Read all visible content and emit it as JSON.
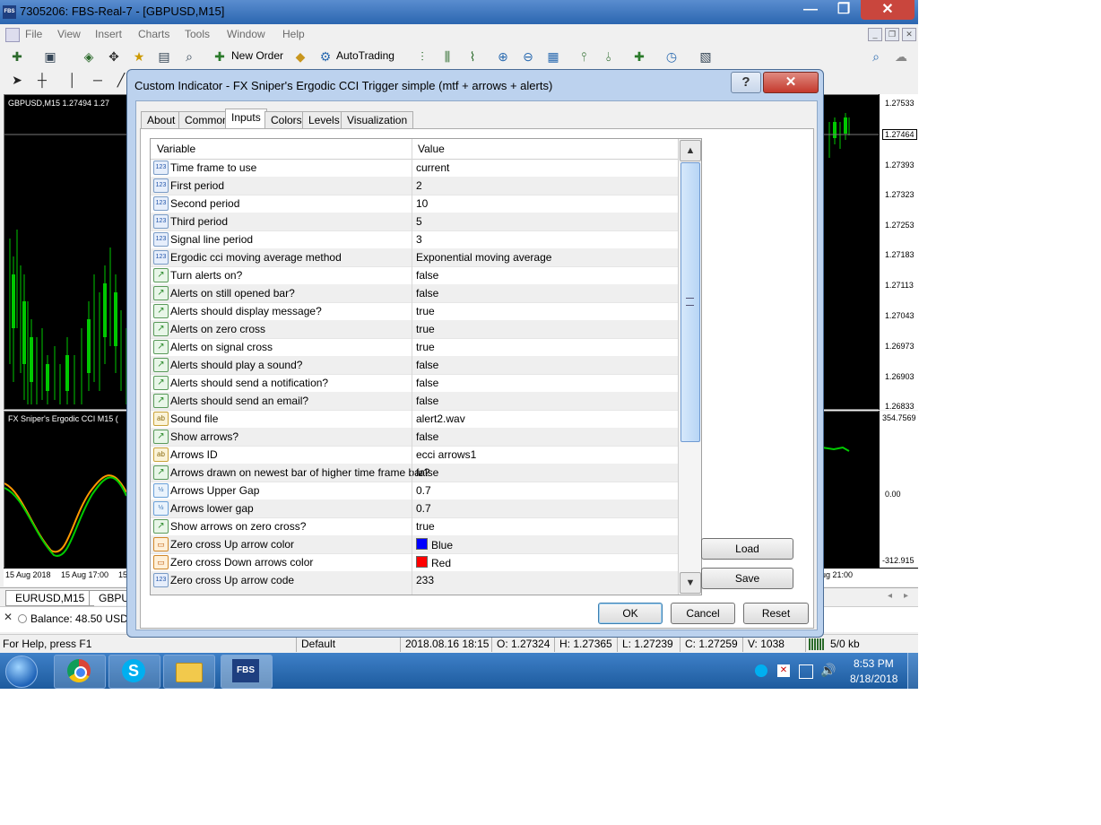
{
  "window": {
    "title": "7305206: FBS-Real-7 - [GBPUSD,M15]",
    "app_icon": "FBS",
    "minimize_label": "—",
    "maximize_label": "❐",
    "close_label": "✕"
  },
  "menu": [
    "File",
    "View",
    "Insert",
    "Charts",
    "Tools",
    "Window",
    "Help"
  ],
  "toolbar": {
    "new_order_label": "New Order",
    "autotrading_label": "AutoTrading"
  },
  "chart": {
    "symbol_label": "GBPUSD,M15  1.27494 1.27",
    "price_ticks": [
      "1.27533",
      "1.27464",
      "1.27393",
      "1.27323",
      "1.27253",
      "1.27183",
      "1.27113",
      "1.27043",
      "1.26973",
      "1.26903",
      "1.26833"
    ],
    "current_price": "1.27464",
    "indicator_label": "FX Sniper's Ergodic CCI M15 (",
    "indicator_ticks": [
      "354.7569",
      "0.00",
      "-312.915"
    ],
    "time_labels": [
      "15 Aug 2018",
      "15 Aug 17:00",
      "15",
      "ug 21:00"
    ],
    "tabs": [
      "EURUSD,M15",
      "GBPUS"
    ]
  },
  "terminal": {
    "balance_text": "Balance: 48.50 USD"
  },
  "statusbar": {
    "help": "For Help, press F1",
    "profile": "Default",
    "datetime": "2018.08.16 18:15",
    "open": "O: 1.27324",
    "high": "H: 1.27365",
    "low": "L: 1.27239",
    "close": "C: 1.27259",
    "volume": "V: 1038",
    "traffic": "5/0 kb"
  },
  "taskbar": {
    "time": "8:53 PM",
    "date": "8/18/2018",
    "fbs_label": "FBS"
  },
  "dialog": {
    "title": "Custom Indicator - FX Sniper's Ergodic CCI Trigger simple (mtf + arrows + alerts)",
    "help_label": "?",
    "close_label": "✕",
    "tabs": [
      "About",
      "Common",
      "Inputs",
      "Colors",
      "Levels",
      "Visualization"
    ],
    "active_tab": "Inputs",
    "grid": {
      "col_variable": "Variable",
      "col_value": "Value",
      "rows": [
        {
          "var": "Time frame to use",
          "val": "current",
          "icon": "123"
        },
        {
          "var": "First period",
          "val": "2",
          "icon": "123"
        },
        {
          "var": "Second period",
          "val": "10",
          "icon": "123"
        },
        {
          "var": "Third period",
          "val": "5",
          "icon": "123"
        },
        {
          "var": "Signal line period",
          "val": "3",
          "icon": "123"
        },
        {
          "var": "Ergodic cci moving average method",
          "val": "Exponential moving average",
          "icon": "123"
        },
        {
          "var": "Turn alerts on?",
          "val": "false",
          "icon": "bool"
        },
        {
          "var": "Alerts on still opened bar?",
          "val": "false",
          "icon": "bool"
        },
        {
          "var": "Alerts should display message?",
          "val": "true",
          "icon": "bool"
        },
        {
          "var": "Alerts on zero cross",
          "val": "true",
          "icon": "bool"
        },
        {
          "var": "Alerts on signal cross",
          "val": "true",
          "icon": "bool"
        },
        {
          "var": "Alerts should play a sound?",
          "val": "false",
          "icon": "bool"
        },
        {
          "var": "Alerts should send a notification?",
          "val": "false",
          "icon": "bool"
        },
        {
          "var": "Alerts should send an email?",
          "val": "false",
          "icon": "bool"
        },
        {
          "var": "Sound file",
          "val": "alert2.wav",
          "icon": "ab"
        },
        {
          "var": "Show arrows?",
          "val": "false",
          "icon": "bool"
        },
        {
          "var": "Arrows ID",
          "val": "ecci arrows1",
          "icon": "ab"
        },
        {
          "var": "Arrows drawn on newest bar of higher time frame bar?",
          "val": "false",
          "icon": "bool"
        },
        {
          "var": "Arrows Upper Gap",
          "val": "0.7",
          "icon": "dbl"
        },
        {
          "var": "Arrows lower gap",
          "val": "0.7",
          "icon": "dbl"
        },
        {
          "var": "Show arrows on zero cross?",
          "val": "true",
          "icon": "bool"
        },
        {
          "var": "Zero cross Up arrow color",
          "val": "Blue",
          "icon": "clr",
          "swatch": "#0000ff"
        },
        {
          "var": "Zero cross Down arrows color",
          "val": "Red",
          "icon": "clr",
          "swatch": "#ff0000"
        },
        {
          "var": "Zero cross Up arrow code",
          "val": "233",
          "icon": "123"
        }
      ]
    },
    "buttons": {
      "load": "Load",
      "save": "Save",
      "ok": "OK",
      "cancel": "Cancel",
      "reset": "Reset"
    }
  }
}
